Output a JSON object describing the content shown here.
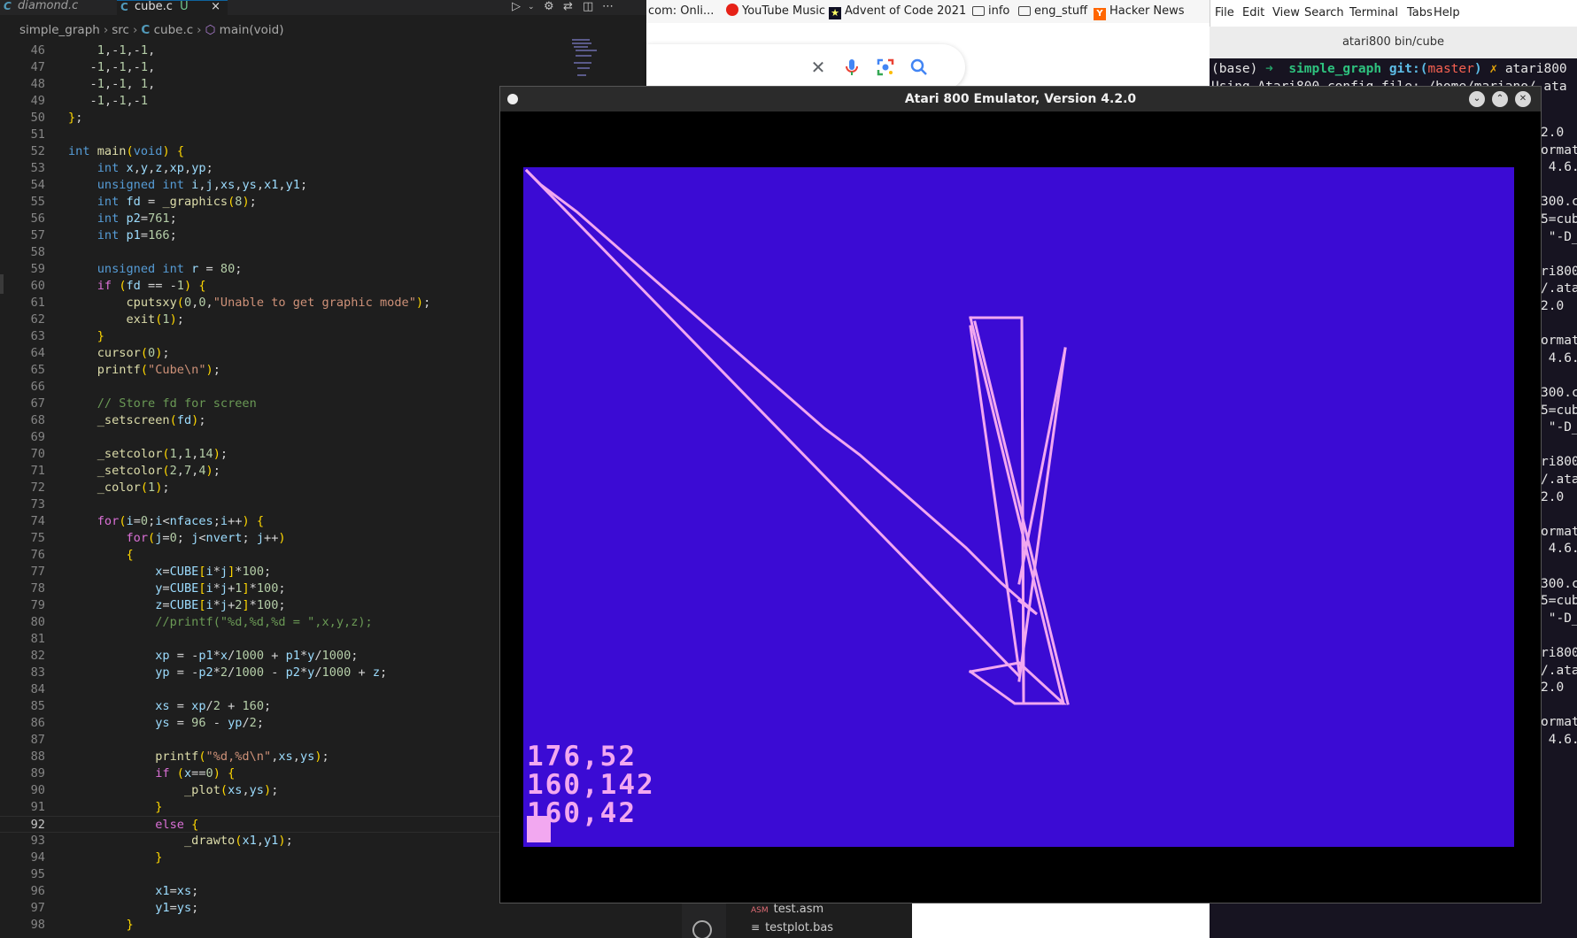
{
  "vscode": {
    "tabs": [
      {
        "label": "diamond.c",
        "icon": "C"
      },
      {
        "label": "cube.c",
        "icon": "C",
        "status": "U",
        "close": "×"
      }
    ],
    "breadcrumb": [
      "simple_graph",
      "src",
      "cube.c",
      "main(void)"
    ],
    "current_line": 92,
    "lines": [
      {
        "n": "46",
        "code": "    1,-1,-1,"
      },
      {
        "n": "47",
        "code": "   -1,-1,-1,"
      },
      {
        "n": "48",
        "code": "   -1,-1, 1,"
      },
      {
        "n": "49",
        "code": "   -1,-1,-1"
      },
      {
        "n": "50",
        "code": "};"
      },
      {
        "n": "51",
        "code": ""
      },
      {
        "n": "52",
        "code": "int main(void) {"
      },
      {
        "n": "53",
        "code": "    int x,y,z,xp,yp;"
      },
      {
        "n": "54",
        "code": "    unsigned int i,j,xs,ys,x1,y1;"
      },
      {
        "n": "55",
        "code": "    int fd = _graphics(8);"
      },
      {
        "n": "56",
        "code": "    int p2=761;"
      },
      {
        "n": "57",
        "code": "    int p1=166;"
      },
      {
        "n": "58",
        "code": ""
      },
      {
        "n": "59",
        "code": "    unsigned int r = 80;"
      },
      {
        "n": "60",
        "code": "    if (fd == -1) {"
      },
      {
        "n": "61",
        "code": "        cputsxy(0,0,\"Unable to get graphic mode\");"
      },
      {
        "n": "62",
        "code": "        exit(1);"
      },
      {
        "n": "63",
        "code": "    }"
      },
      {
        "n": "64",
        "code": "    cursor(0);"
      },
      {
        "n": "65",
        "code": "    printf(\"Cube\\n\");"
      },
      {
        "n": "66",
        "code": ""
      },
      {
        "n": "67",
        "code": "    // Store fd for screen"
      },
      {
        "n": "68",
        "code": "    _setscreen(fd);"
      },
      {
        "n": "69",
        "code": ""
      },
      {
        "n": "70",
        "code": "    _setcolor(1,1,14);"
      },
      {
        "n": "71",
        "code": "    _setcolor(2,7,4);"
      },
      {
        "n": "72",
        "code": "    _color(1);"
      },
      {
        "n": "73",
        "code": ""
      },
      {
        "n": "74",
        "code": "    for(i=0;i<nfaces;i++) {"
      },
      {
        "n": "75",
        "code": "        for(j=0; j<nvert; j++)"
      },
      {
        "n": "76",
        "code": "        {"
      },
      {
        "n": "77",
        "code": "            x=CUBE[i*j]*100;"
      },
      {
        "n": "78",
        "code": "            y=CUBE[i*j+1]*100;"
      },
      {
        "n": "79",
        "code": "            z=CUBE[i*j+2]*100;"
      },
      {
        "n": "80",
        "code": "            //printf(\"%d,%d,%d = \",x,y,z);"
      },
      {
        "n": "81",
        "code": ""
      },
      {
        "n": "82",
        "code": "            xp = -p1*x/1000 + p1*y/1000;"
      },
      {
        "n": "83",
        "code": "            yp = -p2*2/1000 - p2*y/1000 + z;"
      },
      {
        "n": "84",
        "code": ""
      },
      {
        "n": "85",
        "code": "            xs = xp/2 + 160;"
      },
      {
        "n": "86",
        "code": "            ys = 96 - yp/2;"
      },
      {
        "n": "87",
        "code": ""
      },
      {
        "n": "88",
        "code": "            printf(\"%d,%d\\n\",xs,ys);"
      },
      {
        "n": "89",
        "code": "            if (x==0) {"
      },
      {
        "n": "90",
        "code": "                _plot(xs,ys);"
      },
      {
        "n": "91",
        "code": "            }"
      },
      {
        "n": "92",
        "code": "            else {"
      },
      {
        "n": "93",
        "code": "                _drawto(x1,y1);"
      },
      {
        "n": "94",
        "code": "            }"
      },
      {
        "n": "95",
        "code": ""
      },
      {
        "n": "96",
        "code": "            x1=xs;"
      },
      {
        "n": "97",
        "code": "            y1=ys;"
      },
      {
        "n": "98",
        "code": "        }"
      }
    ]
  },
  "browser": {
    "bookmarks": [
      {
        "label": "com: Onli...",
        "icon": ""
      },
      {
        "label": "YouTube Music",
        "icon": "youtube-music-icon"
      },
      {
        "label": "Advent of Code 2021",
        "icon": "advent-star-icon"
      },
      {
        "label": "info",
        "icon": "folder-icon"
      },
      {
        "label": "eng_stuff",
        "icon": "folder-icon"
      },
      {
        "label": "Hacker News",
        "icon": "hacker-news-icon"
      }
    ],
    "search_icons": [
      "close-icon",
      "mic-icon",
      "lens-icon",
      "search-icon"
    ]
  },
  "terminal": {
    "menu": [
      "File",
      "Edit",
      "View",
      "Search",
      "Terminal",
      "Tabs",
      "Help"
    ],
    "title": "atari800 bin/cube",
    "prompt_base": "(base)",
    "prompt_arrow": "➜",
    "prompt_dir": "simple_graph",
    "prompt_git": "git:(",
    "prompt_branch": "master",
    "prompt_git_close": ")",
    "prompt_x": "✗",
    "prompt_cmd": "atari800",
    "line2": "Using Atari800 config file: /home/mariano/.ata",
    "right_fragments": [
      "2.0",
      "ormat",
      " 4.6.",
      "",
      "300.c",
      "5=cub",
      " \"-D_",
      "",
      "ri800",
      "/.ata",
      "2.0",
      "",
      "ormat",
      " 4.6.",
      "",
      "300.c",
      "5=cub",
      " \"-D_",
      "",
      "ri800",
      "/.ata",
      "2.0",
      "",
      "ormat",
      " 4.6.",
      "",
      "300.c",
      "5=cub",
      " \"-D_",
      "",
      "ri800",
      "/.ata",
      "2.0",
      "",
      "ormat",
      " 4.6."
    ]
  },
  "files": [
    {
      "label": "test.asm",
      "icon": "asm-file-icon"
    },
    {
      "label": "testplot.bas",
      "icon": "text-file-icon"
    }
  ],
  "emulator": {
    "title": "Atari 800 Emulator, Version 4.2.0",
    "output_lines": [
      "176,52",
      "160,142",
      "160,42"
    ],
    "colors": {
      "background": "#3b0bd4",
      "foreground": "#f2a8f0"
    }
  }
}
